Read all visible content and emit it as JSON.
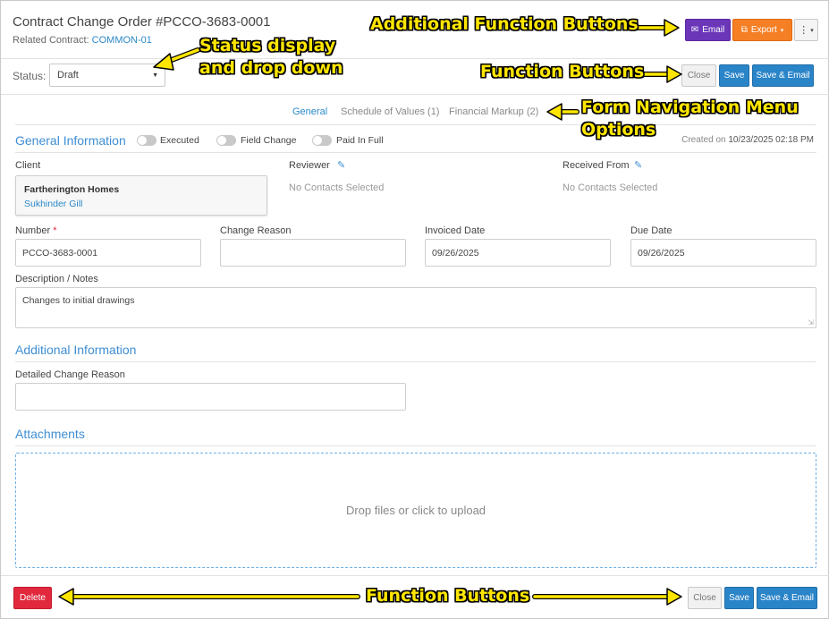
{
  "header": {
    "title": "Contract Change Order #PCCO-3683-0001",
    "related_label": "Related Contract:",
    "related_link": "COMMON-01"
  },
  "top_actions": {
    "email": "Email",
    "export": "Export",
    "email_icon": "envelope-icon",
    "export_icon": "export-icon",
    "more_icon": "kebab-icon"
  },
  "status": {
    "label": "Status:",
    "value": "Draft"
  },
  "form_actions": {
    "close": "Close",
    "save": "Save",
    "save_email": "Save & Email"
  },
  "tabs": [
    {
      "label": "General",
      "active": true
    },
    {
      "label": "Schedule of Values (1)",
      "active": false
    },
    {
      "label": "Financial Markup (2)",
      "active": false
    }
  ],
  "general": {
    "title": "General Information",
    "toggles": [
      {
        "label": "Executed",
        "on": false
      },
      {
        "label": "Field Change",
        "on": false
      },
      {
        "label": "Paid In Full",
        "on": false
      }
    ],
    "created_prefix": "Created on",
    "created_value": "10/23/2025 02:18 PM",
    "client_label": "Client",
    "client_name": "Fartherington Homes",
    "client_contact": "Sukhinder Gill",
    "reviewer_label": "Reviewer",
    "reviewer_value": "No Contacts Selected",
    "received_from_label": "Received From",
    "received_from_value": "No Contacts Selected",
    "number_label": "Number",
    "number_required": "*",
    "number_value": "PCCO-3683-0001",
    "change_reason_label": "Change Reason",
    "change_reason_value": "",
    "invoiced_date_label": "Invoiced Date",
    "invoiced_date_value": "09/26/2025",
    "due_date_label": "Due Date",
    "due_date_value": "09/26/2025",
    "description_label": "Description / Notes",
    "description_value": "Changes to initial drawings"
  },
  "additional": {
    "title": "Additional Information",
    "detailed_reason_label": "Detailed Change Reason",
    "detailed_reason_value": ""
  },
  "attachments": {
    "title": "Attachments",
    "dropzone_text": "Drop files or click to upload"
  },
  "footer_actions": {
    "delete": "Delete",
    "close": "Close",
    "save": "Save",
    "save_email": "Save & Email"
  },
  "annotations": {
    "additional_buttons": "Additional Function Buttons",
    "status_line1": "Status display",
    "status_line2": "and drop down",
    "function_buttons_top": "Function Buttons",
    "nav_line1": "Form Navigation Menu",
    "nav_line2": "Options",
    "function_buttons_bottom": "Function Buttons",
    "color": "#ffe600"
  }
}
